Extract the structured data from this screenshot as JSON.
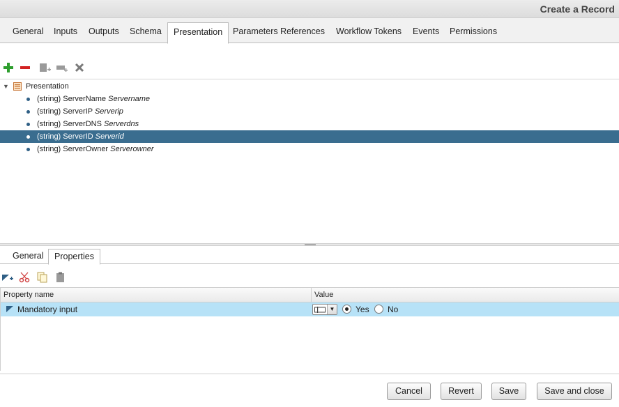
{
  "window": {
    "title": "Create a Record"
  },
  "tabs": [
    {
      "label": "General"
    },
    {
      "label": "Inputs"
    },
    {
      "label": "Outputs"
    },
    {
      "label": "Schema"
    },
    {
      "label": "Presentation"
    },
    {
      "label": "Parameters References"
    },
    {
      "label": "Workflow Tokens"
    },
    {
      "label": "Events"
    },
    {
      "label": "Permissions"
    }
  ],
  "active_tab": "Presentation",
  "tree": {
    "root_label": "Presentation",
    "items": [
      {
        "type": "(string)",
        "name": "ServerName",
        "alias": "Servername",
        "selected": false
      },
      {
        "type": "(string)",
        "name": "ServerIP",
        "alias": "Serverip",
        "selected": false
      },
      {
        "type": "(string)",
        "name": "ServerDNS",
        "alias": "Serverdns",
        "selected": false
      },
      {
        "type": "(string)",
        "name": "ServerID",
        "alias": "Serverid",
        "selected": true
      },
      {
        "type": "(string)",
        "name": "ServerOwner",
        "alias": "Serverowner",
        "selected": false
      }
    ]
  },
  "lower_tabs": [
    {
      "label": "General"
    },
    {
      "label": "Properties"
    }
  ],
  "active_lower_tab": "Properties",
  "properties": {
    "col_name": "Property name",
    "col_value": "Value",
    "rows": [
      {
        "name": "Mandatory input",
        "yes_label": "Yes",
        "no_label": "No",
        "selected": "Yes"
      }
    ]
  },
  "buttons": {
    "cancel": "Cancel",
    "revert": "Revert",
    "save": "Save",
    "save_close": "Save and close"
  },
  "colors": {
    "selection": "#3a6d8f",
    "property_row": "#b7e2f7",
    "add": "#2e9e2e",
    "remove": "#d22222"
  }
}
